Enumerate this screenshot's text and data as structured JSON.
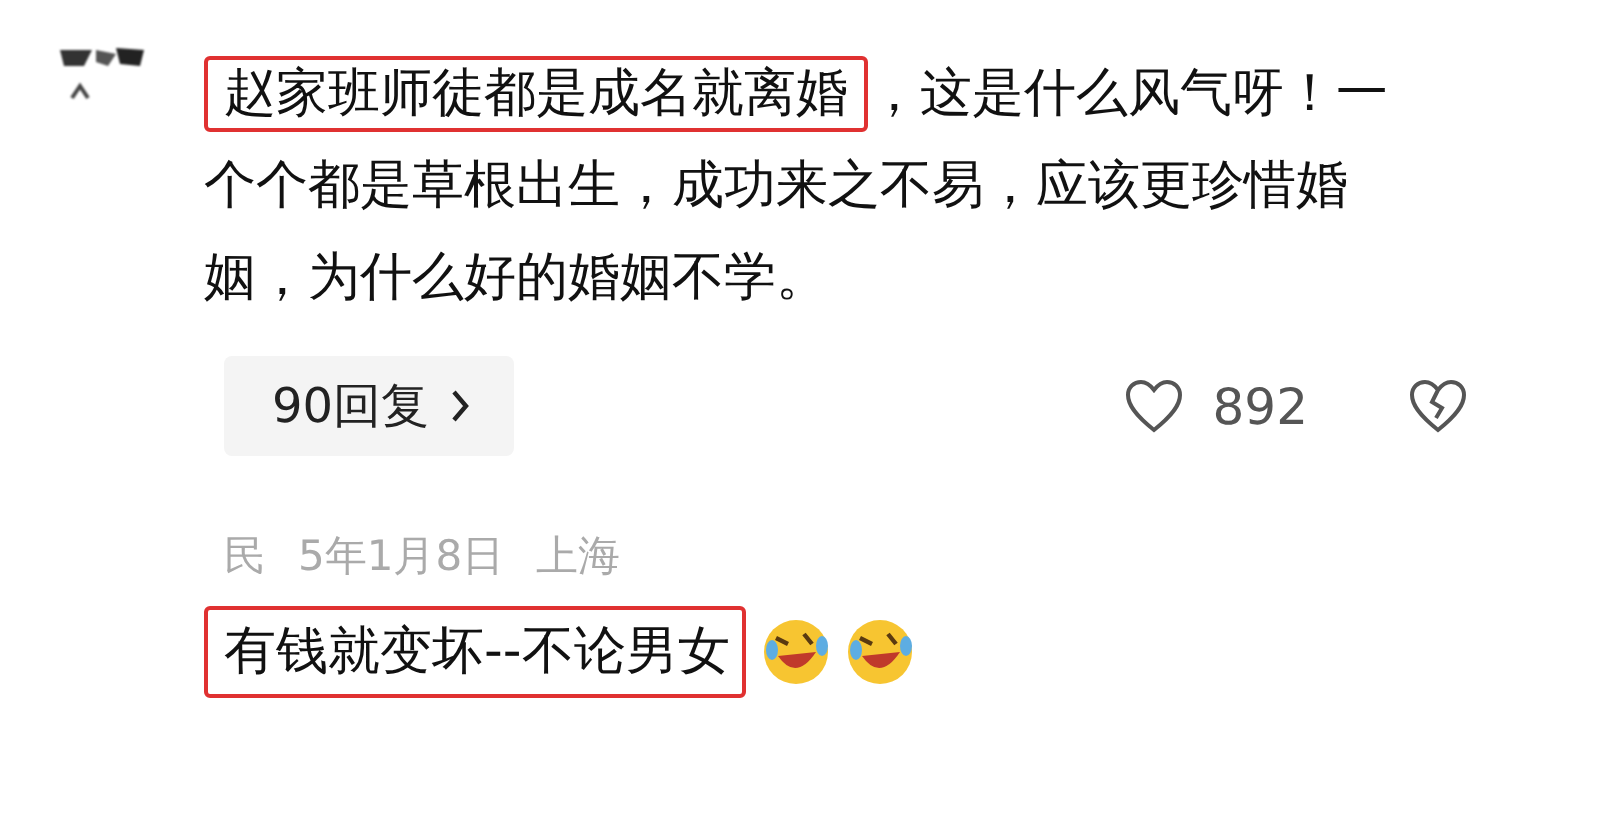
{
  "comment": {
    "text_parts": [
      {
        "text": "赵家班师徒都是成名就离婚",
        "highlighted": true
      },
      {
        "text": "，这是什么风气呀！一个个都是草根出生，成功来之不易，应该更珍惜婚姻，为什么好的婚姻不学。",
        "highlighted": false
      }
    ],
    "reply_button": "90回复",
    "like_count": "892"
  },
  "reply": {
    "author": "民",
    "date": "5年1月8日",
    "location": "上海",
    "text_parts": [
      {
        "text": "有钱就变坏--不论男女",
        "highlighted": true
      }
    ],
    "emojis": [
      {
        "kind": "laughing"
      },
      {
        "kind": "laughing"
      }
    ]
  }
}
